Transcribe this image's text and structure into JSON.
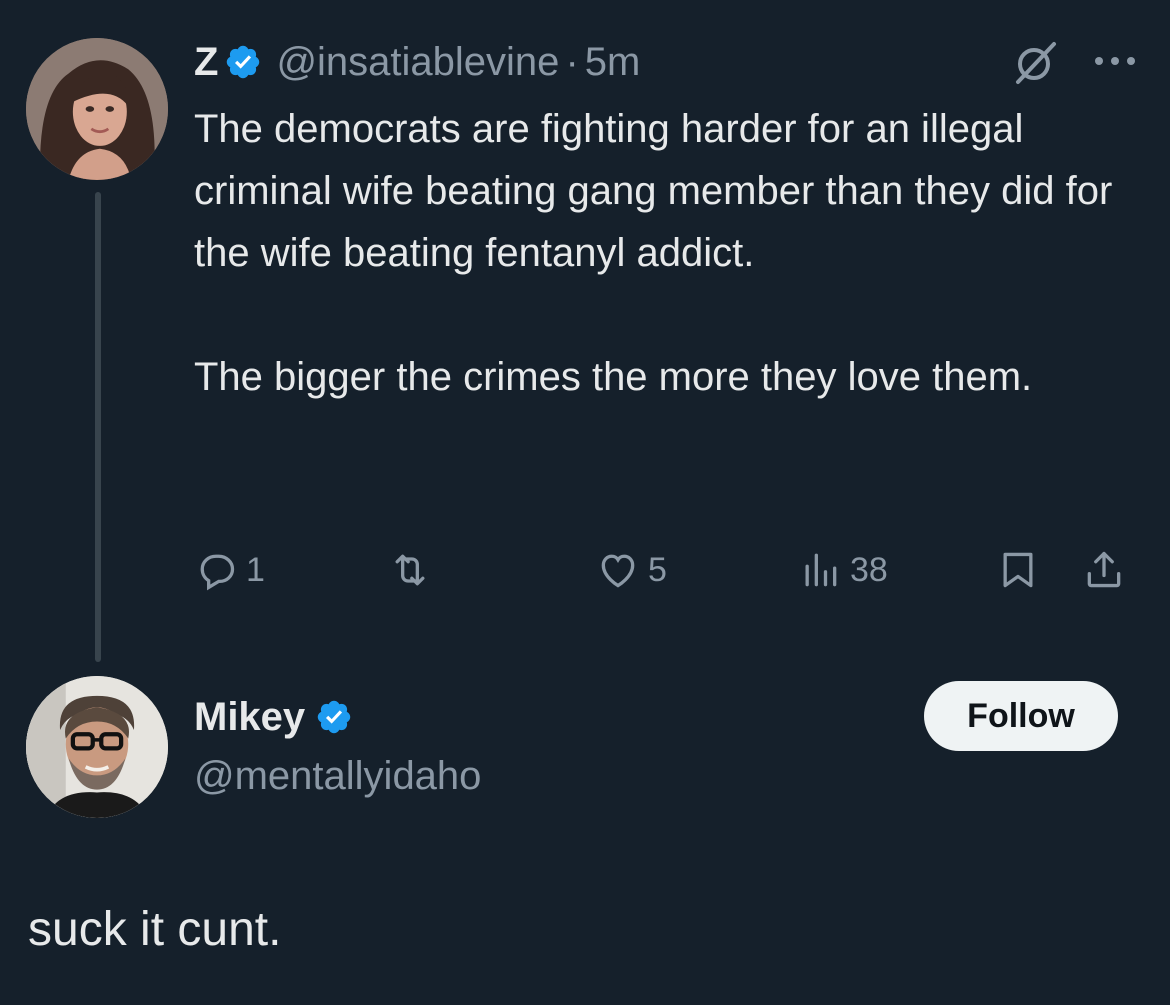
{
  "tweet": {
    "author": {
      "display_name": "Z",
      "handle": "@insatiablevine",
      "verified": true,
      "avatar": "avatar-woman"
    },
    "separator": "·",
    "time": "5m",
    "paragraphs": [
      "The democrats are fighting harder for an illegal criminal wife beating gang member than they did for the wife beating fentanyl addict.",
      "The bigger the crimes the more they love them."
    ],
    "actions": {
      "reply_count": "1",
      "retweet_count": "",
      "like_count": "5",
      "views_count": "38"
    },
    "icons": {
      "header": [
        "grok-icon",
        "more-icon"
      ],
      "actions": [
        "reply-icon",
        "retweet-icon",
        "like-icon",
        "views-icon",
        "bookmark-icon",
        "share-icon"
      ]
    }
  },
  "reply": {
    "author": {
      "display_name": "Mikey",
      "handle": "@mentallyidaho",
      "verified": true,
      "avatar": "avatar-man"
    },
    "follow_label": "Follow",
    "text": "suck it cunt."
  },
  "colors": {
    "background": "#15202b",
    "text": "#e7e9ea",
    "secondary": "#8b98a5",
    "verified": "#1d9bf0",
    "thread_line": "#38444d",
    "follow_bg": "#eff3f4"
  }
}
